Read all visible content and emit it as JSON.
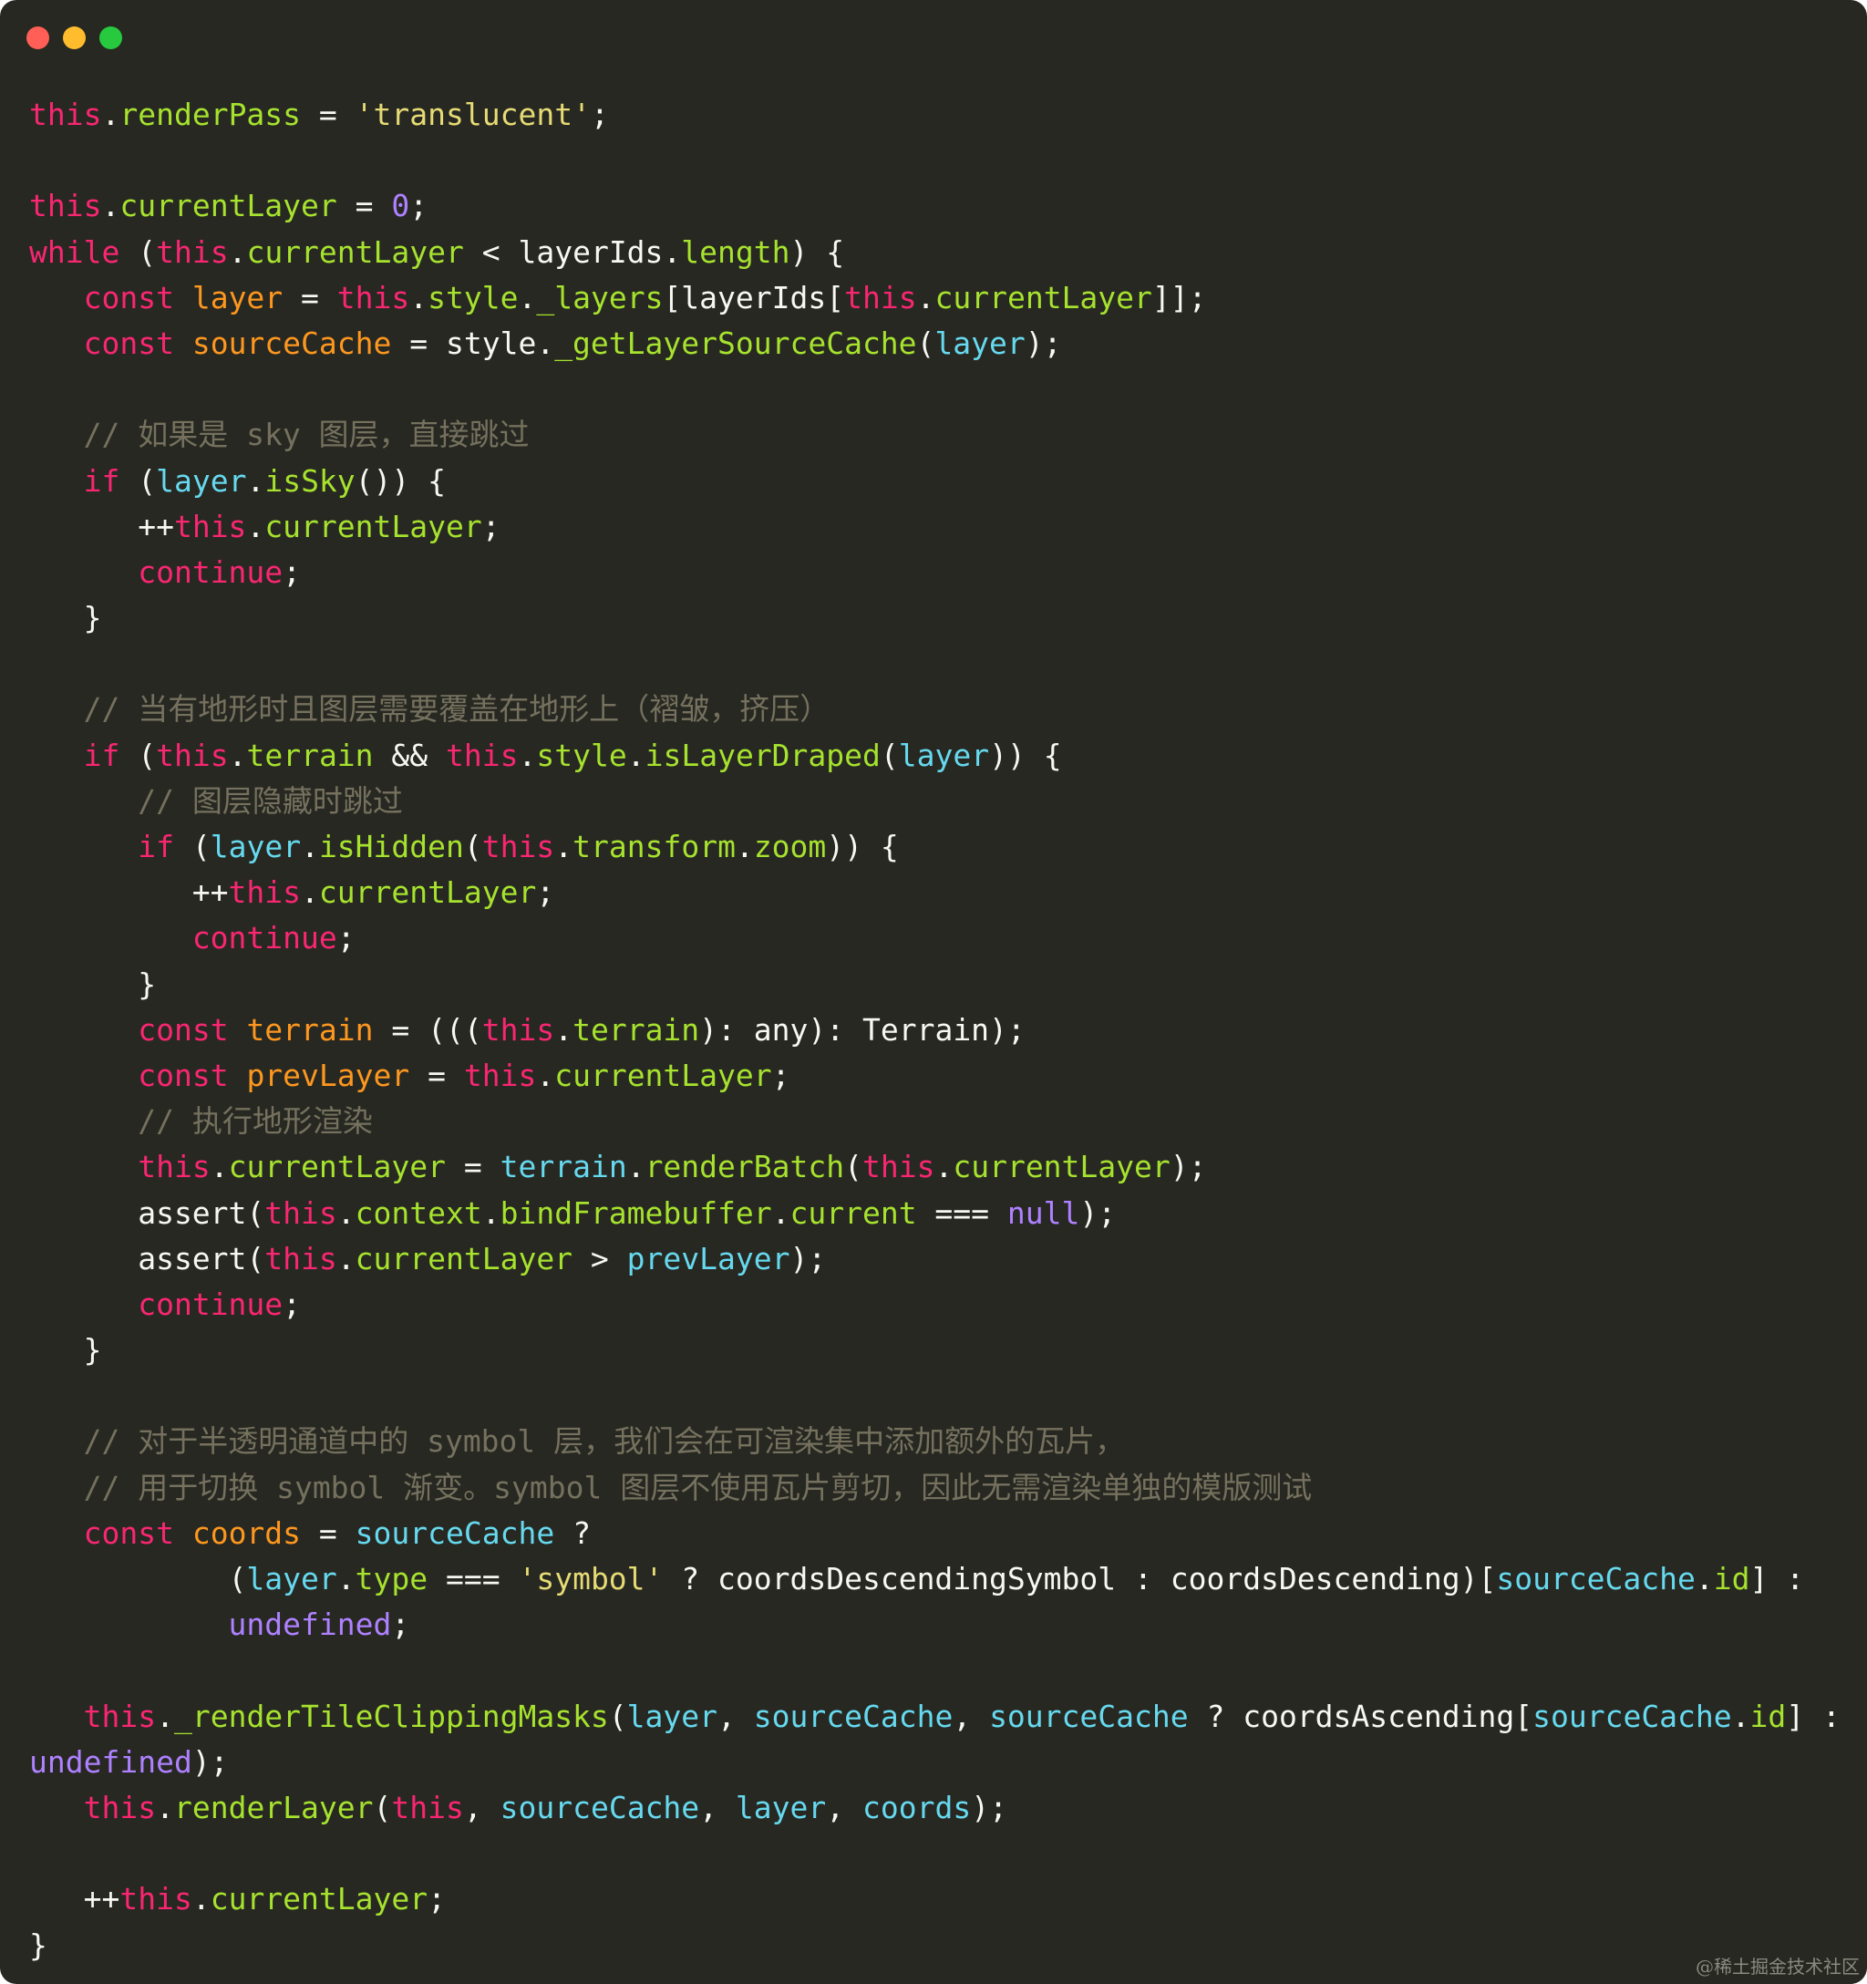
{
  "window": {
    "background": "#272822",
    "controls": [
      {
        "name": "close",
        "color": "#ff5f56"
      },
      {
        "name": "minimize",
        "color": "#ffbd2e"
      },
      {
        "name": "maximize",
        "color": "#27c93f"
      }
    ]
  },
  "theme": {
    "t": "#f8f8f2",
    "k": "#f92672",
    "p": "#a6e22e",
    "s": "#e6db74",
    "n": "#ae81ff",
    "v": "#fd971f",
    "b": "#66d9ef",
    "c": "#75715e"
  },
  "code": {
    "lines": [
      [
        [
          "k",
          "this"
        ],
        [
          "t",
          "."
        ],
        [
          "p",
          "renderPass"
        ],
        [
          "t",
          " = "
        ],
        [
          "s",
          "'translucent'"
        ],
        [
          "t",
          ";"
        ]
      ],
      [],
      [
        [
          "k",
          "this"
        ],
        [
          "t",
          "."
        ],
        [
          "p",
          "currentLayer"
        ],
        [
          "t",
          " = "
        ],
        [
          "n",
          "0"
        ],
        [
          "t",
          ";"
        ]
      ],
      [
        [
          "k",
          "while"
        ],
        [
          "t",
          " ("
        ],
        [
          "k",
          "this"
        ],
        [
          "t",
          "."
        ],
        [
          "p",
          "currentLayer"
        ],
        [
          "t",
          " < layerIds."
        ],
        [
          "p",
          "length"
        ],
        [
          "t",
          ") {"
        ]
      ],
      [
        [
          "t",
          "   "
        ],
        [
          "k",
          "const"
        ],
        [
          "t",
          " "
        ],
        [
          "v",
          "layer"
        ],
        [
          "t",
          " = "
        ],
        [
          "k",
          "this"
        ],
        [
          "t",
          "."
        ],
        [
          "p",
          "style"
        ],
        [
          "t",
          "."
        ],
        [
          "p",
          "_layers"
        ],
        [
          "t",
          "[layerIds["
        ],
        [
          "k",
          "this"
        ],
        [
          "t",
          "."
        ],
        [
          "p",
          "currentLayer"
        ],
        [
          "t",
          "]];"
        ]
      ],
      [
        [
          "t",
          "   "
        ],
        [
          "k",
          "const"
        ],
        [
          "t",
          " "
        ],
        [
          "v",
          "sourceCache"
        ],
        [
          "t",
          " = style."
        ],
        [
          "p",
          "_getLayerSourceCache"
        ],
        [
          "t",
          "("
        ],
        [
          "b",
          "layer"
        ],
        [
          "t",
          ");"
        ]
      ],
      [],
      [
        [
          "t",
          "   "
        ],
        [
          "c",
          "// 如果是 sky 图层，直接跳过"
        ]
      ],
      [
        [
          "t",
          "   "
        ],
        [
          "k",
          "if"
        ],
        [
          "t",
          " ("
        ],
        [
          "b",
          "layer"
        ],
        [
          "t",
          "."
        ],
        [
          "p",
          "isSky"
        ],
        [
          "t",
          "()) {"
        ]
      ],
      [
        [
          "t",
          "      ++"
        ],
        [
          "k",
          "this"
        ],
        [
          "t",
          "."
        ],
        [
          "p",
          "currentLayer"
        ],
        [
          "t",
          ";"
        ]
      ],
      [
        [
          "t",
          "      "
        ],
        [
          "k",
          "continue"
        ],
        [
          "t",
          ";"
        ]
      ],
      [
        [
          "t",
          "   }"
        ]
      ],
      [],
      [
        [
          "t",
          "   "
        ],
        [
          "c",
          "// 当有地形时且图层需要覆盖在地形上（褶皱，挤压）"
        ]
      ],
      [
        [
          "t",
          "   "
        ],
        [
          "k",
          "if"
        ],
        [
          "t",
          " ("
        ],
        [
          "k",
          "this"
        ],
        [
          "t",
          "."
        ],
        [
          "p",
          "terrain"
        ],
        [
          "t",
          " && "
        ],
        [
          "k",
          "this"
        ],
        [
          "t",
          "."
        ],
        [
          "p",
          "style"
        ],
        [
          "t",
          "."
        ],
        [
          "p",
          "isLayerDraped"
        ],
        [
          "t",
          "("
        ],
        [
          "b",
          "layer"
        ],
        [
          "t",
          ")) {"
        ]
      ],
      [
        [
          "t",
          "      "
        ],
        [
          "c",
          "// 图层隐藏时跳过"
        ]
      ],
      [
        [
          "t",
          "      "
        ],
        [
          "k",
          "if"
        ],
        [
          "t",
          " ("
        ],
        [
          "b",
          "layer"
        ],
        [
          "t",
          "."
        ],
        [
          "p",
          "isHidden"
        ],
        [
          "t",
          "("
        ],
        [
          "k",
          "this"
        ],
        [
          "t",
          "."
        ],
        [
          "p",
          "transform"
        ],
        [
          "t",
          "."
        ],
        [
          "p",
          "zoom"
        ],
        [
          "t",
          ")) {"
        ]
      ],
      [
        [
          "t",
          "         ++"
        ],
        [
          "k",
          "this"
        ],
        [
          "t",
          "."
        ],
        [
          "p",
          "currentLayer"
        ],
        [
          "t",
          ";"
        ]
      ],
      [
        [
          "t",
          "         "
        ],
        [
          "k",
          "continue"
        ],
        [
          "t",
          ";"
        ]
      ],
      [
        [
          "t",
          "      }"
        ]
      ],
      [
        [
          "t",
          "      "
        ],
        [
          "k",
          "const"
        ],
        [
          "t",
          " "
        ],
        [
          "v",
          "terrain"
        ],
        [
          "t",
          " = ((("
        ],
        [
          "k",
          "this"
        ],
        [
          "t",
          "."
        ],
        [
          "p",
          "terrain"
        ],
        [
          "t",
          "): any): Terrain);"
        ]
      ],
      [
        [
          "t",
          "      "
        ],
        [
          "k",
          "const"
        ],
        [
          "t",
          " "
        ],
        [
          "v",
          "prevLayer"
        ],
        [
          "t",
          " = "
        ],
        [
          "k",
          "this"
        ],
        [
          "t",
          "."
        ],
        [
          "p",
          "currentLayer"
        ],
        [
          "t",
          ";"
        ]
      ],
      [
        [
          "t",
          "      "
        ],
        [
          "c",
          "// 执行地形渲染"
        ]
      ],
      [
        [
          "t",
          "      "
        ],
        [
          "k",
          "this"
        ],
        [
          "t",
          "."
        ],
        [
          "p",
          "currentLayer"
        ],
        [
          "t",
          " = "
        ],
        [
          "b",
          "terrain"
        ],
        [
          "t",
          "."
        ],
        [
          "p",
          "renderBatch"
        ],
        [
          "t",
          "("
        ],
        [
          "k",
          "this"
        ],
        [
          "t",
          "."
        ],
        [
          "p",
          "currentLayer"
        ],
        [
          "t",
          ");"
        ]
      ],
      [
        [
          "t",
          "      assert("
        ],
        [
          "k",
          "this"
        ],
        [
          "t",
          "."
        ],
        [
          "p",
          "context"
        ],
        [
          "t",
          "."
        ],
        [
          "p",
          "bindFramebuffer"
        ],
        [
          "t",
          "."
        ],
        [
          "p",
          "current"
        ],
        [
          "t",
          " === "
        ],
        [
          "n",
          "null"
        ],
        [
          "t",
          ");"
        ]
      ],
      [
        [
          "t",
          "      assert("
        ],
        [
          "k",
          "this"
        ],
        [
          "t",
          "."
        ],
        [
          "p",
          "currentLayer"
        ],
        [
          "t",
          " > "
        ],
        [
          "b",
          "prevLayer"
        ],
        [
          "t",
          ");"
        ]
      ],
      [
        [
          "t",
          "      "
        ],
        [
          "k",
          "continue"
        ],
        [
          "t",
          ";"
        ]
      ],
      [
        [
          "t",
          "   }"
        ]
      ],
      [],
      [
        [
          "t",
          "   "
        ],
        [
          "c",
          "// 对于半透明通道中的 symbol 层，我们会在可渲染集中添加额外的瓦片，"
        ]
      ],
      [
        [
          "t",
          "   "
        ],
        [
          "c",
          "// 用于切换 symbol 渐变。symbol 图层不使用瓦片剪切，因此无需渲染单独的模版测试"
        ]
      ],
      [
        [
          "t",
          "   "
        ],
        [
          "k",
          "const"
        ],
        [
          "t",
          " "
        ],
        [
          "v",
          "coords"
        ],
        [
          "t",
          " = "
        ],
        [
          "b",
          "sourceCache"
        ],
        [
          "t",
          " ?"
        ]
      ],
      [
        [
          "t",
          "           ("
        ],
        [
          "b",
          "layer"
        ],
        [
          "t",
          "."
        ],
        [
          "p",
          "type"
        ],
        [
          "t",
          " === "
        ],
        [
          "s",
          "'symbol'"
        ],
        [
          "t",
          " ? coordsDescendingSymbol : coordsDescending)["
        ],
        [
          "b",
          "sourceCache"
        ],
        [
          "t",
          "."
        ],
        [
          "p",
          "id"
        ],
        [
          "t",
          "] :"
        ]
      ],
      [
        [
          "t",
          "           "
        ],
        [
          "n",
          "undefined"
        ],
        [
          "t",
          ";"
        ]
      ],
      [],
      [
        [
          "t",
          "   "
        ],
        [
          "k",
          "this"
        ],
        [
          "t",
          "."
        ],
        [
          "p",
          "_renderTileClippingMasks"
        ],
        [
          "t",
          "("
        ],
        [
          "b",
          "layer"
        ],
        [
          "t",
          ", "
        ],
        [
          "b",
          "sourceCache"
        ],
        [
          "t",
          ", "
        ],
        [
          "b",
          "sourceCache"
        ],
        [
          "t",
          " ? coordsAscending["
        ],
        [
          "b",
          "sourceCache"
        ],
        [
          "t",
          "."
        ],
        [
          "p",
          "id"
        ],
        [
          "t",
          "] :"
        ]
      ],
      [
        [
          "n",
          "undefined"
        ],
        [
          "t",
          ");"
        ]
      ],
      [
        [
          "t",
          "   "
        ],
        [
          "k",
          "this"
        ],
        [
          "t",
          "."
        ],
        [
          "p",
          "renderLayer"
        ],
        [
          "t",
          "("
        ],
        [
          "k",
          "this"
        ],
        [
          "t",
          ", "
        ],
        [
          "b",
          "sourceCache"
        ],
        [
          "t",
          ", "
        ],
        [
          "b",
          "layer"
        ],
        [
          "t",
          ", "
        ],
        [
          "b",
          "coords"
        ],
        [
          "t",
          ");"
        ]
      ],
      [],
      [
        [
          "t",
          "   ++"
        ],
        [
          "k",
          "this"
        ],
        [
          "t",
          "."
        ],
        [
          "p",
          "currentLayer"
        ],
        [
          "t",
          ";"
        ]
      ],
      [
        [
          "t",
          "}"
        ]
      ]
    ]
  },
  "watermark": {
    "text": "@稀土掘金技术社区"
  }
}
